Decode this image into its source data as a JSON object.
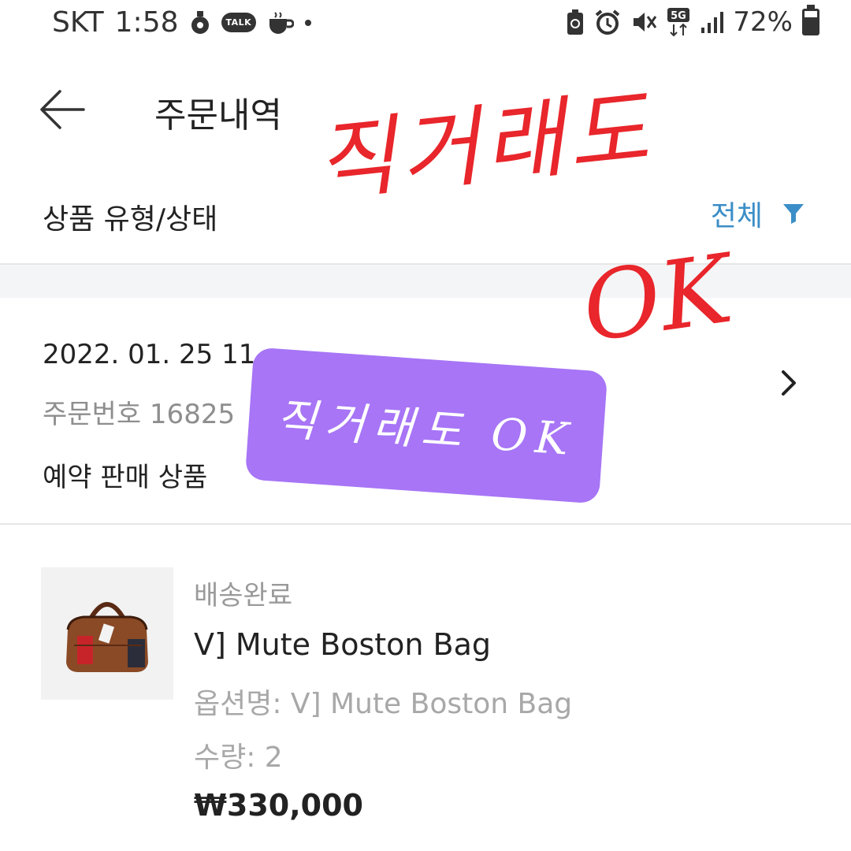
{
  "status_bar": {
    "carrier": "SKT",
    "time": "1:58",
    "talk_label": "TALK",
    "network": "5G",
    "battery": "72%",
    "battery_level": 0.72
  },
  "header": {
    "title": "주문내역"
  },
  "filter": {
    "label": "상품 유형/상태",
    "value": "전체",
    "accent_color": "#3b8ec7"
  },
  "order": {
    "date": "2022. 01. 25 11",
    "number": "주문번호 16825",
    "type": "예약 판매 상품"
  },
  "product": {
    "status": "배송완료",
    "name": "V] Mute Boston Bag",
    "option": "옵션명: V] Mute Boston Bag",
    "quantity": "수량: 2",
    "price": "₩330,000"
  },
  "overlays": {
    "sticker_text": "직거래도 OK",
    "sticker_color": "#a775f6",
    "handwriting_text": "직거래도",
    "handwriting_ok": "OK",
    "handwriting_color": "#e8262b"
  }
}
